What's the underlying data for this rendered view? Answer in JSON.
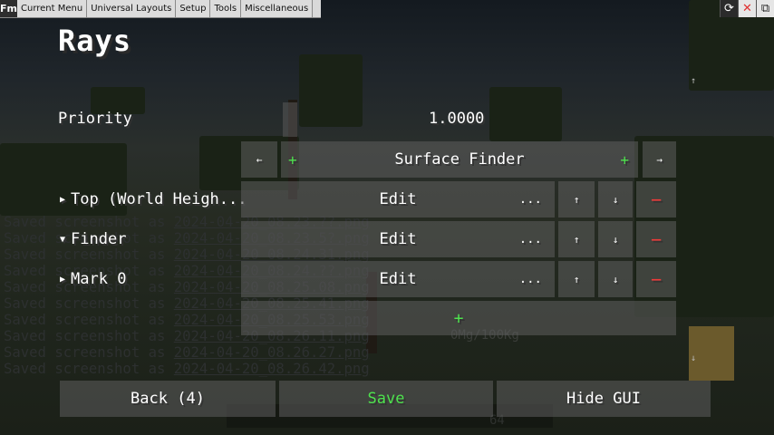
{
  "menubar": {
    "logo": "Fm",
    "items": [
      "Current Menu",
      "Universal Layouts",
      "Setup",
      "Tools",
      "Miscellaneous"
    ]
  },
  "window_controls": {
    "refresh": "⟳",
    "close": "✕",
    "restore": "⧉"
  },
  "title": "Rays",
  "priority": {
    "label": "Priority",
    "value": "1.0000"
  },
  "finder_selector": {
    "prev": "←",
    "add_left": "+",
    "label": "Surface Finder",
    "add_right": "+",
    "next": "→"
  },
  "rows": [
    {
      "label": "Top (World Heigh...",
      "expanded": false,
      "edit": "Edit",
      "more": "...",
      "up": "↑",
      "down": "↓",
      "remove": "−"
    },
    {
      "label": "Finder",
      "expanded": true,
      "edit": "Edit",
      "more": "...",
      "up": "↑",
      "down": "↓",
      "remove": "−"
    },
    {
      "label": "Mark 0",
      "expanded": false,
      "edit": "Edit",
      "more": "...",
      "up": "↑",
      "down": "↓",
      "remove": "−"
    }
  ],
  "add_row": "+",
  "scroll": {
    "up": "↑",
    "down": "↓"
  },
  "footer": {
    "back": "Back (4)",
    "save": "Save",
    "hide": "Hide GUI"
  },
  "log_prefix": "Saved screenshot as ",
  "log_files": [
    "2024-04-20_08.23.??.png",
    "2024-04-20_08.23.5?.png",
    "2024-04-20_08.24.31.png",
    "2024-04-20_08.24.??.png",
    "2024-04-20_08.25.08.png",
    "2024-04-20_08.25.41.png",
    "2024-04-20_08.25.53.png",
    "2024-04-20_08.26.11.png",
    "2024-04-20_08.26.27.png",
    "2024-04-20_08.26.42.png"
  ],
  "background_text": {
    "weight": "0Mg/100Kg",
    "count": "64"
  }
}
